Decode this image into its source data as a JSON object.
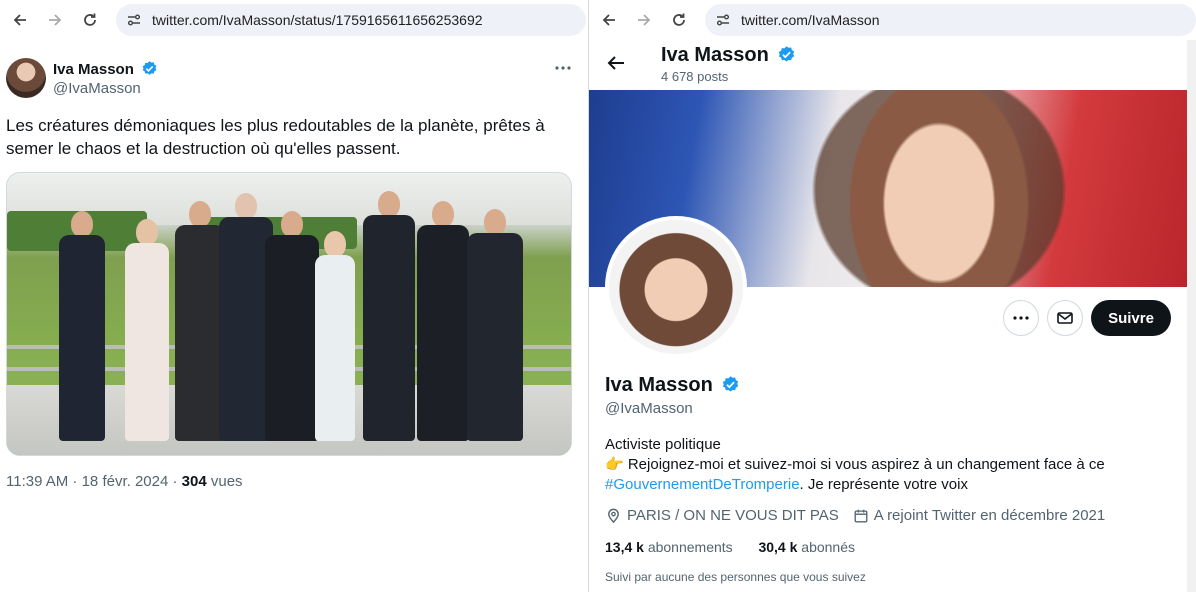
{
  "left_browser": {
    "url": "twitter.com/IvaMasson/status/1759165611656253692"
  },
  "tweet": {
    "author_name": "Iva Masson",
    "author_handle": "@IvaMasson",
    "text": "Les créatures démoniaques les plus redoutables de la planète, prêtes à semer le chaos et la destruction où qu'elles passent.",
    "time": "11:39 AM · 18 févr. 2024 · ",
    "views_count": "304",
    "views_label": " vues"
  },
  "right_browser": {
    "url": "twitter.com/IvaMasson"
  },
  "profile": {
    "header_name": "Iva Masson",
    "posts_count": "4 678 posts",
    "name": "Iva Masson",
    "handle": "@IvaMasson",
    "follow_label": "Suivre",
    "bio_line1": "Activiste politique",
    "bio_line2": "👉 Rejoignez-moi et suivez-moi si vous aspirez à un changement face à ce",
    "bio_hashtag": "#GouvernementDeTromperie",
    "bio_line3_rest": ". Je représente votre voix",
    "location": "PARIS / ON NE VOUS DIT PAS",
    "joined": "A rejoint Twitter en décembre 2021",
    "following_count": "13,4 k",
    "following_label": " abonnements",
    "followers_count": "30,4 k",
    "followers_label": " abonnés",
    "followed_by": "Suivi par aucune des personnes que vous suivez"
  },
  "colors": {
    "verified_blue": "#1d9bf0",
    "text_primary": "#0f1419",
    "text_secondary": "#536471",
    "url_bar_bg": "#eef1f8"
  },
  "icons": [
    "back-arrow-icon",
    "forward-arrow-icon",
    "reload-icon",
    "site-settings-icon",
    "verified-badge-icon",
    "more-icon",
    "message-icon",
    "location-icon",
    "calendar-icon"
  ]
}
